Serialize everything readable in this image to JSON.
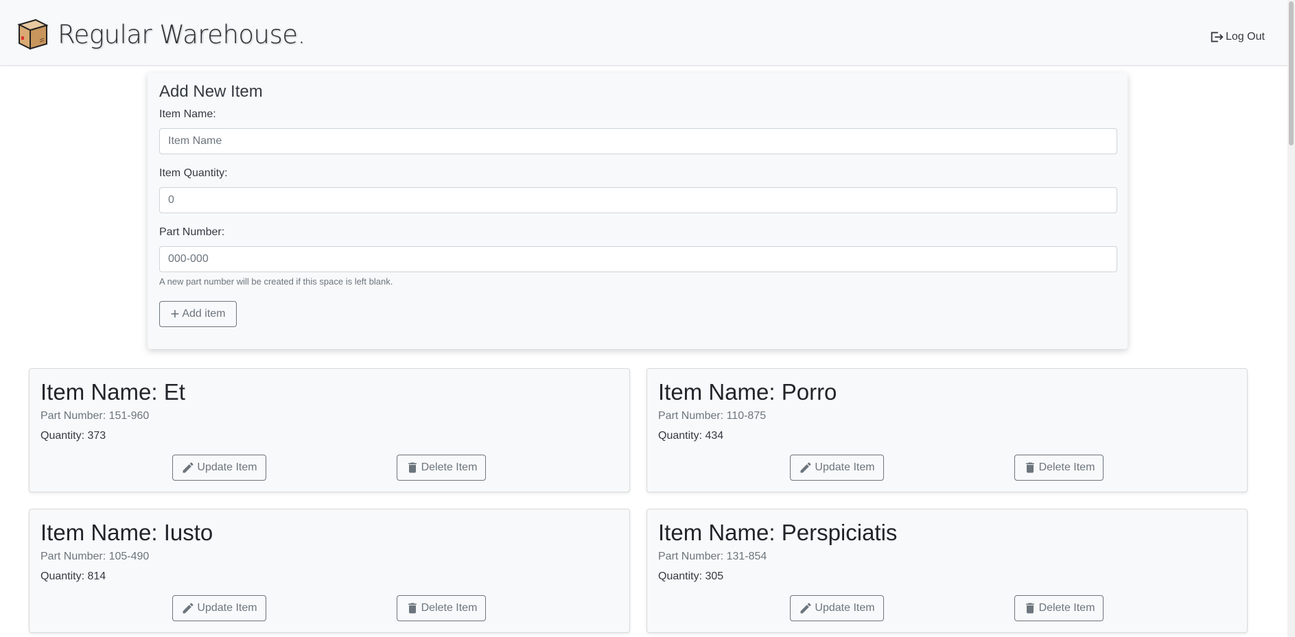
{
  "header": {
    "title": "Regular Warehouse.",
    "logout_label": "Log Out",
    "logo_icon": "cardboard-box-icon"
  },
  "add_form": {
    "title": "Add New Item",
    "name_label": "Item Name:",
    "name_placeholder": "Item Name",
    "quantity_label": "Item Quantity:",
    "quantity_placeholder": "0",
    "part_label": "Part Number:",
    "part_placeholder": "000-000",
    "part_help": "A new part number will be created if this space is left blank.",
    "add_button_label": "Add item"
  },
  "items": [
    {
      "name": "Item Name: Et",
      "part": "Part Number: 151-960",
      "quantity": "Quantity: 373",
      "update_label": "Update Item",
      "delete_label": "Delete Item"
    },
    {
      "name": "Item Name: Porro",
      "part": "Part Number: 110-875",
      "quantity": "Quantity: 434",
      "update_label": "Update Item",
      "delete_label": "Delete Item"
    },
    {
      "name": "Item Name: Iusto",
      "part": "Part Number: 105-490",
      "quantity": "Quantity: 814",
      "update_label": "Update Item",
      "delete_label": "Delete Item"
    },
    {
      "name": "Item Name: Perspiciatis",
      "part": "Part Number: 131-854",
      "quantity": "Quantity: 305",
      "update_label": "Update Item",
      "delete_label": "Delete Item"
    }
  ],
  "colors": {
    "card_bg": "#f8f9fa",
    "secondary": "#6c757d",
    "box_brown": "#c8955c"
  }
}
